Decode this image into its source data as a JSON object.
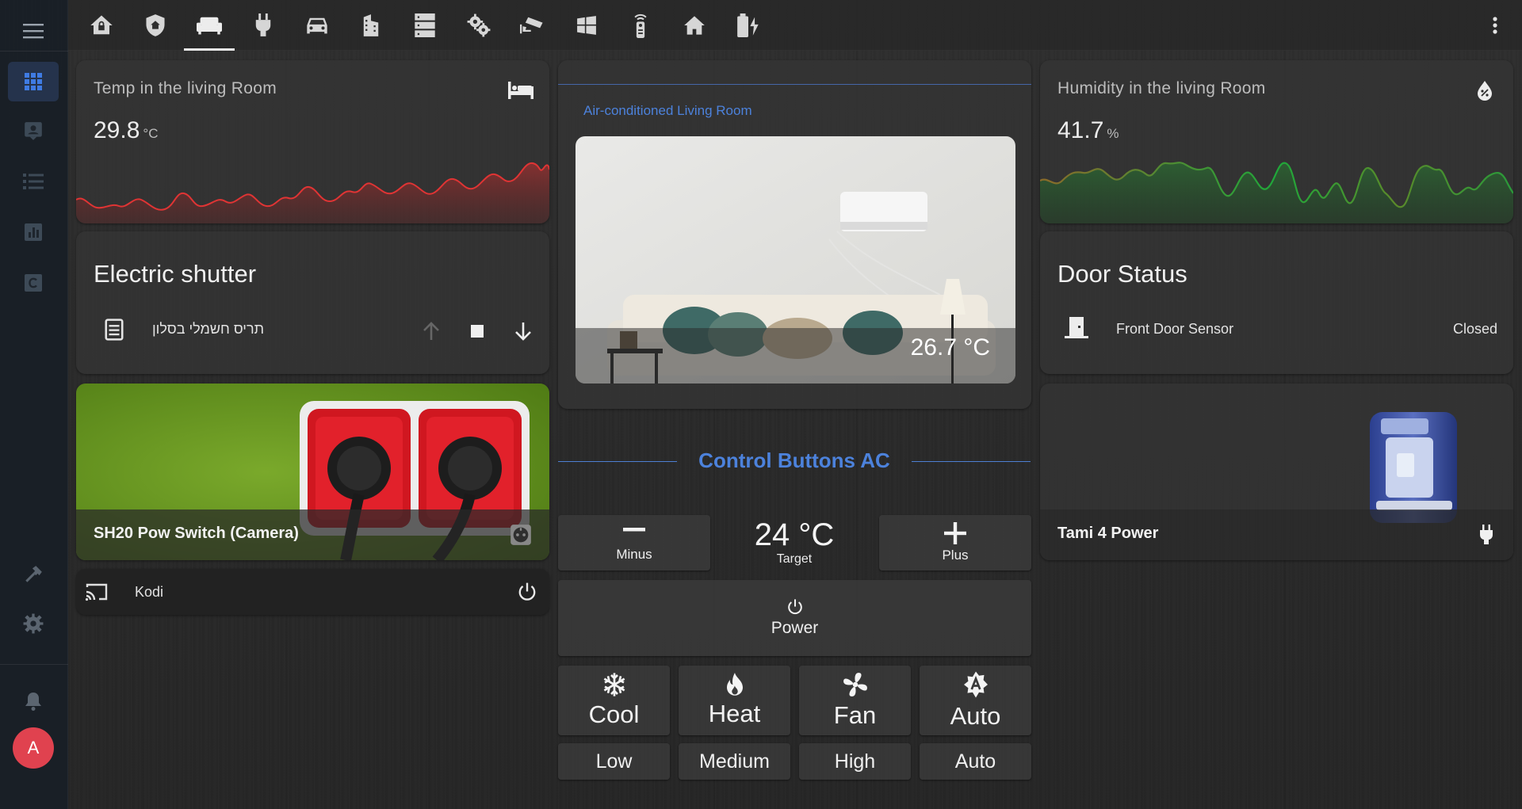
{
  "topbar": {
    "tabs": [
      {
        "icon": "home-lock-icon"
      },
      {
        "icon": "shield-home-icon"
      },
      {
        "icon": "sofa-icon",
        "active": true
      },
      {
        "icon": "power-plug-icon"
      },
      {
        "icon": "car-icon"
      },
      {
        "icon": "office-building-icon"
      },
      {
        "icon": "server-icon"
      },
      {
        "icon": "cogs-icon"
      },
      {
        "icon": "cctv-icon"
      },
      {
        "icon": "windows-icon"
      },
      {
        "icon": "remote-icon"
      },
      {
        "icon": "home-icon"
      },
      {
        "icon": "battery-charging-icon"
      }
    ]
  },
  "sidebar": {
    "items": [
      {
        "icon": "grid-icon",
        "active": true
      },
      {
        "icon": "account-box-icon"
      },
      {
        "icon": "format-list-icon"
      },
      {
        "icon": "chart-box-icon"
      },
      {
        "icon": "alpha-c-box-icon"
      }
    ],
    "bottom": [
      {
        "icon": "hammer-icon"
      },
      {
        "icon": "gear-icon"
      },
      {
        "icon": "bell-icon"
      }
    ],
    "avatar_letter": "A"
  },
  "temp_card": {
    "name": "Temp in the living Room",
    "value": "29.8",
    "unit": "°C",
    "icon": "bed-icon",
    "line_color": "#d93030"
  },
  "humidity_card": {
    "name": "Humidity in the living Room",
    "value": "41.7",
    "unit": "%",
    "icon": "water-percent-icon"
  },
  "shutter_card": {
    "title": "Electric shutter",
    "entity_name": "תריס חשמלי בסלון",
    "icon": "window-shutter-icon"
  },
  "door_card": {
    "title": "Door Status",
    "sensor_name": "Front Door Sensor",
    "state": "Closed",
    "icon": "door-closed-icon"
  },
  "ac_card": {
    "header": "Air-conditioned Living Room",
    "current_temp": "26.7 °C"
  },
  "switch_card": {
    "name": "SH20 Pow Switch (Camera)",
    "icon": "power-socket-icon"
  },
  "kodi_card": {
    "name": "Kodi",
    "icon": "cast-icon"
  },
  "tami_card": {
    "name": "Tami 4 Power",
    "icon": "power-plug-icon"
  },
  "ac_controls": {
    "title": "Control Buttons AC",
    "minus_label": "Minus",
    "plus_label": "Plus",
    "target_value": "24 °C",
    "target_label": "Target",
    "power_label": "Power",
    "modes": [
      {
        "label": "Cool",
        "icon": "snowflake-icon"
      },
      {
        "label": "Heat",
        "icon": "fire-icon"
      },
      {
        "label": "Fan",
        "icon": "fan-icon"
      },
      {
        "label": "Auto",
        "icon": "auto-mode-icon"
      }
    ],
    "fan_speeds": [
      "Low",
      "Medium",
      "High",
      "Auto"
    ]
  },
  "colors": {
    "accent_blue": "#4c82dc",
    "avatar_red": "#e0424f",
    "temp_red": "#d93030",
    "humidity_green": "#22c040"
  }
}
